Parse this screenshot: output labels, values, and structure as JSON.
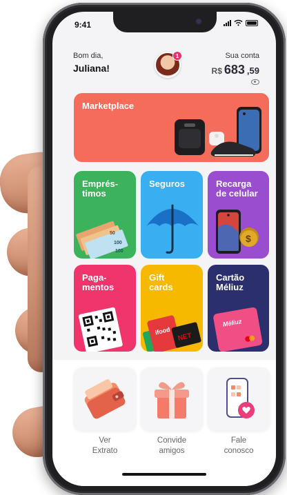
{
  "status": {
    "time": "9:41"
  },
  "header": {
    "greeting": "Bom dia,",
    "user_name": "Juliana!",
    "notification_count": "1",
    "account_label": "Sua conta",
    "currency": "R$",
    "balance_int": "683",
    "balance_cents": ",59"
  },
  "banner": {
    "label": "Marketplace"
  },
  "tiles": [
    {
      "label": "Emprés-\ntimos"
    },
    {
      "label": "Seguros"
    },
    {
      "label": "Recarga\nde celular"
    },
    {
      "label": "Paga-\nmentos"
    },
    {
      "label": "Gift\ncards"
    },
    {
      "label": "Cartão\nMéliuz"
    }
  ],
  "card_brand": "Méliuz",
  "gift_card_text": "NET",
  "money_notes": [
    "50",
    "100",
    "100"
  ],
  "actions": [
    {
      "label": "Ver\nExtrato"
    },
    {
      "label": "Convide\namigos"
    },
    {
      "label": "Fale\nconosco"
    }
  ]
}
